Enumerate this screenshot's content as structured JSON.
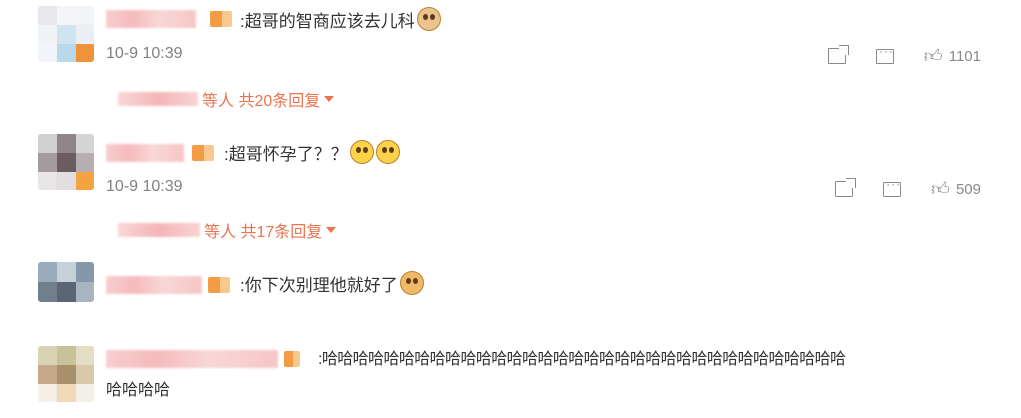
{
  "comments": [
    {
      "text": ":超哥的智商应该去儿科",
      "emoji": "cat-face-emoji",
      "time": "10-9 10:39",
      "likes": "1101",
      "replies": "等人 共20条回复"
    },
    {
      "text": ":超哥怀孕了？？",
      "emoji": "shocked-face-emoji",
      "time": "10-9 10:39",
      "likes": "509",
      "replies": "等人 共17条回复"
    },
    {
      "text": ":你下次别理他就好了",
      "emoji": "doge-emoji"
    },
    {
      "text_line1": ":哈哈哈哈哈哈哈哈哈哈哈哈哈哈哈哈哈哈哈哈哈哈哈哈哈哈哈哈哈哈哈哈哈哈",
      "text_line2": "哈哈哈哈"
    }
  ],
  "icons": {
    "share": "share-icon",
    "comment": "comment-icon",
    "like": "thumbs-up-icon",
    "expand": "caret-down-icon"
  },
  "colors": {
    "accent": "#eb7350",
    "meta": "#808080",
    "text": "#333333"
  }
}
